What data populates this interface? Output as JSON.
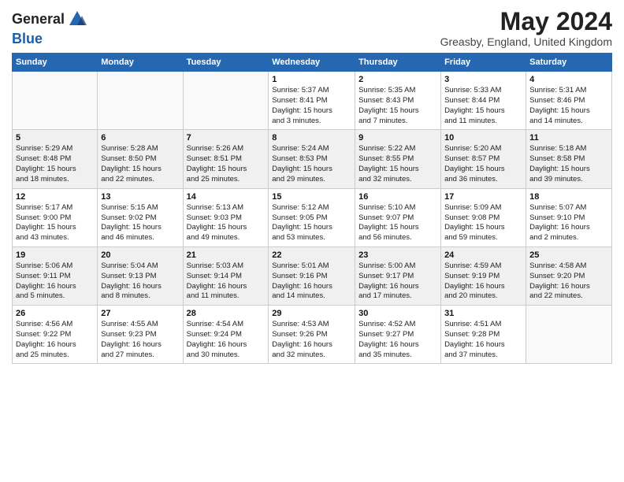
{
  "header": {
    "logo_line1": "General",
    "logo_line2": "Blue",
    "month_year": "May 2024",
    "location": "Greasby, England, United Kingdom"
  },
  "days_of_week": [
    "Sunday",
    "Monday",
    "Tuesday",
    "Wednesday",
    "Thursday",
    "Friday",
    "Saturday"
  ],
  "weeks": [
    [
      {
        "day": "",
        "info": ""
      },
      {
        "day": "",
        "info": ""
      },
      {
        "day": "",
        "info": ""
      },
      {
        "day": "1",
        "info": "Sunrise: 5:37 AM\nSunset: 8:41 PM\nDaylight: 15 hours\nand 3 minutes."
      },
      {
        "day": "2",
        "info": "Sunrise: 5:35 AM\nSunset: 8:43 PM\nDaylight: 15 hours\nand 7 minutes."
      },
      {
        "day": "3",
        "info": "Sunrise: 5:33 AM\nSunset: 8:44 PM\nDaylight: 15 hours\nand 11 minutes."
      },
      {
        "day": "4",
        "info": "Sunrise: 5:31 AM\nSunset: 8:46 PM\nDaylight: 15 hours\nand 14 minutes."
      }
    ],
    [
      {
        "day": "5",
        "info": "Sunrise: 5:29 AM\nSunset: 8:48 PM\nDaylight: 15 hours\nand 18 minutes."
      },
      {
        "day": "6",
        "info": "Sunrise: 5:28 AM\nSunset: 8:50 PM\nDaylight: 15 hours\nand 22 minutes."
      },
      {
        "day": "7",
        "info": "Sunrise: 5:26 AM\nSunset: 8:51 PM\nDaylight: 15 hours\nand 25 minutes."
      },
      {
        "day": "8",
        "info": "Sunrise: 5:24 AM\nSunset: 8:53 PM\nDaylight: 15 hours\nand 29 minutes."
      },
      {
        "day": "9",
        "info": "Sunrise: 5:22 AM\nSunset: 8:55 PM\nDaylight: 15 hours\nand 32 minutes."
      },
      {
        "day": "10",
        "info": "Sunrise: 5:20 AM\nSunset: 8:57 PM\nDaylight: 15 hours\nand 36 minutes."
      },
      {
        "day": "11",
        "info": "Sunrise: 5:18 AM\nSunset: 8:58 PM\nDaylight: 15 hours\nand 39 minutes."
      }
    ],
    [
      {
        "day": "12",
        "info": "Sunrise: 5:17 AM\nSunset: 9:00 PM\nDaylight: 15 hours\nand 43 minutes."
      },
      {
        "day": "13",
        "info": "Sunrise: 5:15 AM\nSunset: 9:02 PM\nDaylight: 15 hours\nand 46 minutes."
      },
      {
        "day": "14",
        "info": "Sunrise: 5:13 AM\nSunset: 9:03 PM\nDaylight: 15 hours\nand 49 minutes."
      },
      {
        "day": "15",
        "info": "Sunrise: 5:12 AM\nSunset: 9:05 PM\nDaylight: 15 hours\nand 53 minutes."
      },
      {
        "day": "16",
        "info": "Sunrise: 5:10 AM\nSunset: 9:07 PM\nDaylight: 15 hours\nand 56 minutes."
      },
      {
        "day": "17",
        "info": "Sunrise: 5:09 AM\nSunset: 9:08 PM\nDaylight: 15 hours\nand 59 minutes."
      },
      {
        "day": "18",
        "info": "Sunrise: 5:07 AM\nSunset: 9:10 PM\nDaylight: 16 hours\nand 2 minutes."
      }
    ],
    [
      {
        "day": "19",
        "info": "Sunrise: 5:06 AM\nSunset: 9:11 PM\nDaylight: 16 hours\nand 5 minutes."
      },
      {
        "day": "20",
        "info": "Sunrise: 5:04 AM\nSunset: 9:13 PM\nDaylight: 16 hours\nand 8 minutes."
      },
      {
        "day": "21",
        "info": "Sunrise: 5:03 AM\nSunset: 9:14 PM\nDaylight: 16 hours\nand 11 minutes."
      },
      {
        "day": "22",
        "info": "Sunrise: 5:01 AM\nSunset: 9:16 PM\nDaylight: 16 hours\nand 14 minutes."
      },
      {
        "day": "23",
        "info": "Sunrise: 5:00 AM\nSunset: 9:17 PM\nDaylight: 16 hours\nand 17 minutes."
      },
      {
        "day": "24",
        "info": "Sunrise: 4:59 AM\nSunset: 9:19 PM\nDaylight: 16 hours\nand 20 minutes."
      },
      {
        "day": "25",
        "info": "Sunrise: 4:58 AM\nSunset: 9:20 PM\nDaylight: 16 hours\nand 22 minutes."
      }
    ],
    [
      {
        "day": "26",
        "info": "Sunrise: 4:56 AM\nSunset: 9:22 PM\nDaylight: 16 hours\nand 25 minutes."
      },
      {
        "day": "27",
        "info": "Sunrise: 4:55 AM\nSunset: 9:23 PM\nDaylight: 16 hours\nand 27 minutes."
      },
      {
        "day": "28",
        "info": "Sunrise: 4:54 AM\nSunset: 9:24 PM\nDaylight: 16 hours\nand 30 minutes."
      },
      {
        "day": "29",
        "info": "Sunrise: 4:53 AM\nSunset: 9:26 PM\nDaylight: 16 hours\nand 32 minutes."
      },
      {
        "day": "30",
        "info": "Sunrise: 4:52 AM\nSunset: 9:27 PM\nDaylight: 16 hours\nand 35 minutes."
      },
      {
        "day": "31",
        "info": "Sunrise: 4:51 AM\nSunset: 9:28 PM\nDaylight: 16 hours\nand 37 minutes."
      },
      {
        "day": "",
        "info": ""
      }
    ]
  ]
}
